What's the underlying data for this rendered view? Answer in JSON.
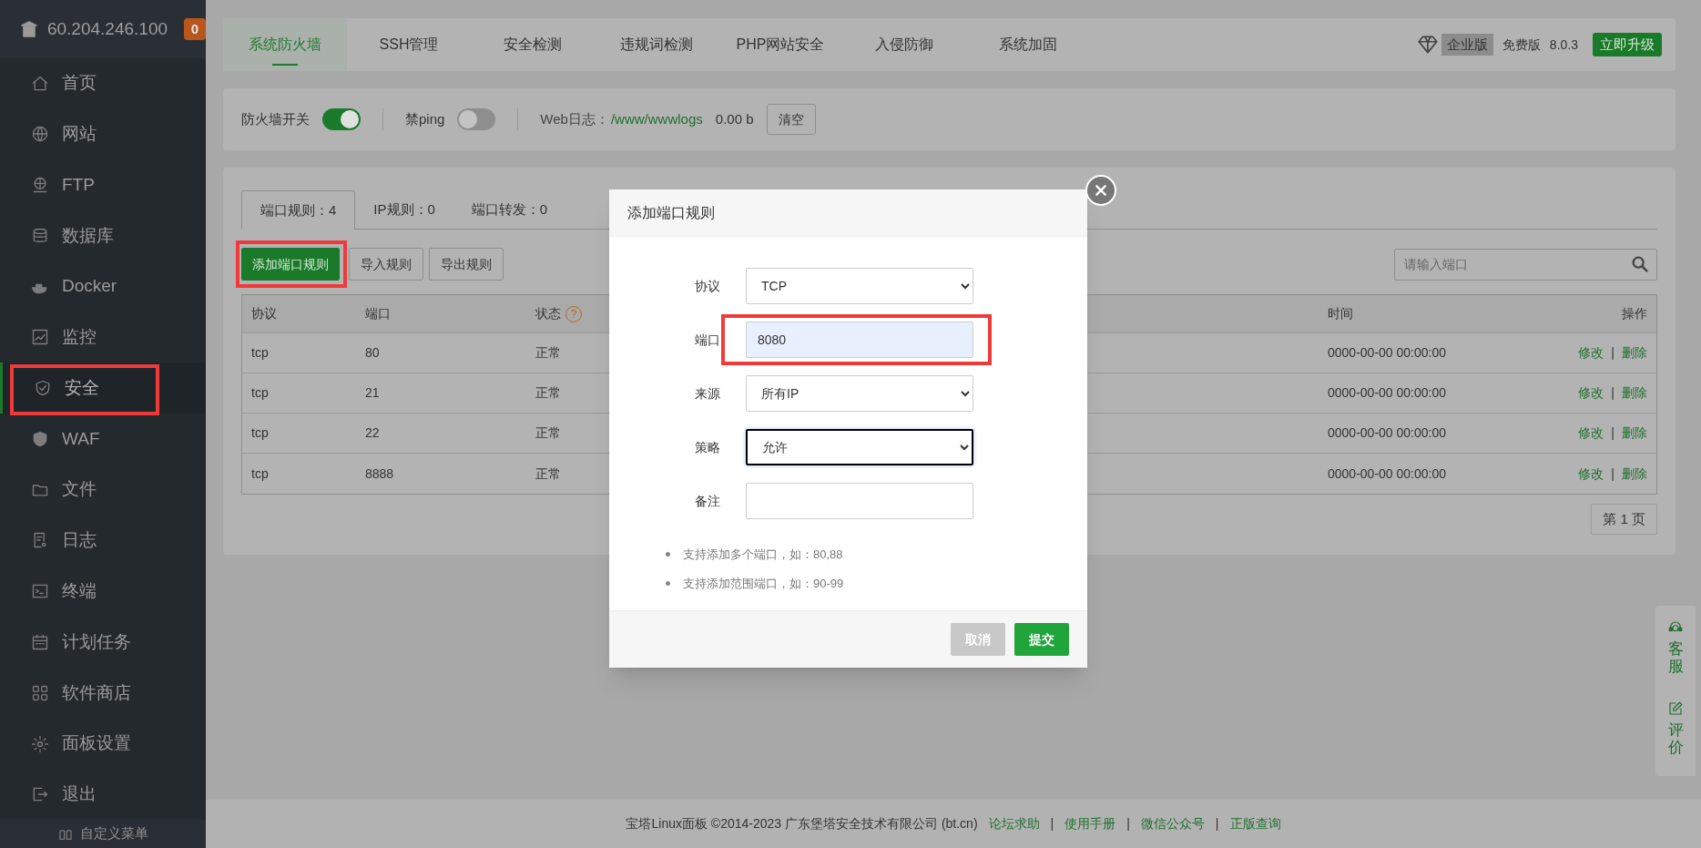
{
  "sidebar": {
    "host": "60.204.246.100",
    "badge": "0",
    "items": [
      {
        "label": "首页",
        "selected": false,
        "highlighted": false
      },
      {
        "label": "网站",
        "selected": false,
        "highlighted": false
      },
      {
        "label": "FTP",
        "selected": false,
        "highlighted": false
      },
      {
        "label": "数据库",
        "selected": false,
        "highlighted": false
      },
      {
        "label": "Docker",
        "selected": false,
        "highlighted": false
      },
      {
        "label": "监控",
        "selected": false,
        "highlighted": false
      },
      {
        "label": "安全",
        "selected": true,
        "highlighted": true
      },
      {
        "label": "WAF",
        "selected": false,
        "highlighted": false
      },
      {
        "label": "文件",
        "selected": false,
        "highlighted": false
      },
      {
        "label": "日志",
        "selected": false,
        "highlighted": false
      },
      {
        "label": "终端",
        "selected": false,
        "highlighted": false
      },
      {
        "label": "计划任务",
        "selected": false,
        "highlighted": false
      },
      {
        "label": "软件商店",
        "selected": false,
        "highlighted": false
      },
      {
        "label": "面板设置",
        "selected": false,
        "highlighted": false
      },
      {
        "label": "退出",
        "selected": false,
        "highlighted": false
      }
    ],
    "custom_menu": "自定义菜单"
  },
  "top_tabs": [
    {
      "label": "系统防火墙",
      "selected": true
    },
    {
      "label": "SSH管理",
      "selected": false
    },
    {
      "label": "安全检测",
      "selected": false
    },
    {
      "label": "违规词检测",
      "selected": false
    },
    {
      "label": "PHP网站安全",
      "selected": false
    },
    {
      "label": "入侵防御",
      "selected": false
    },
    {
      "label": "系统加固",
      "selected": false
    }
  ],
  "edition": {
    "enterprise": "企业版",
    "free": "免费版",
    "version": "8.0.3",
    "upgrade": "立即升级"
  },
  "controls": {
    "firewall_label": "防火墙开关",
    "firewall_on": true,
    "ping_label": "禁ping",
    "ping_on": false,
    "log_label": "Web日志：",
    "log_path": "/www/wwwlogs",
    "log_size": "0.00 b",
    "clear": "清空"
  },
  "rule_tabs": [
    {
      "label": "端口规则：4",
      "selected": true
    },
    {
      "label": "IP规则：0",
      "selected": false
    },
    {
      "label": "端口转发：0",
      "selected": false
    }
  ],
  "actions": [
    {
      "label": "添加端口规则",
      "primary": true,
      "highlighted": true
    },
    {
      "label": "导入规则",
      "primary": false,
      "highlighted": false
    },
    {
      "label": "导出规则",
      "primary": false,
      "highlighted": false
    }
  ],
  "search": {
    "placeholder": "请输入端口"
  },
  "table": {
    "columns": [
      {
        "label": "协议"
      },
      {
        "label": "端口"
      },
      {
        "label": "状态",
        "help": "?"
      },
      {
        "label": "时间"
      },
      {
        "label": "操作"
      }
    ],
    "separator": "|",
    "rows": [
      {
        "protocol": "tcp",
        "port": "80",
        "status": "正常",
        "time": "0000-00-00 00:00:00",
        "actions": [
          "修改",
          "删除"
        ]
      },
      {
        "protocol": "tcp",
        "port": "21",
        "status": "正常",
        "time": "0000-00-00 00:00:00",
        "actions": [
          "修改",
          "删除"
        ]
      },
      {
        "protocol": "tcp",
        "port": "22",
        "status": "正常",
        "time": "0000-00-00 00:00:00",
        "actions": [
          "修改",
          "删除"
        ]
      },
      {
        "protocol": "tcp",
        "port": "8888",
        "status": "正常",
        "time": "0000-00-00 00:00:00",
        "actions": [
          "修改",
          "删除"
        ]
      }
    ]
  },
  "pager": "第 1 页",
  "footer": {
    "text": "宝塔Linux面板 ©2014-2023 广东堡塔安全技术有限公司 (bt.cn)",
    "separator": "|",
    "links": [
      "论坛求助",
      "使用手册",
      "微信公众号",
      "正版查询"
    ]
  },
  "side_widget": [
    {
      "label": "客服",
      "kind": "headset"
    },
    {
      "label": "评价",
      "kind": "edit"
    }
  ],
  "dialog": {
    "title": "添加端口规则",
    "fields": [
      {
        "label": "协议",
        "kind": "select",
        "value": "TCP",
        "focused": false,
        "highlighted": false
      },
      {
        "label": "端口",
        "kind": "input",
        "value": "8080",
        "focused": false,
        "highlighted": true
      },
      {
        "label": "来源",
        "kind": "select",
        "value": "所有IP",
        "focused": false,
        "highlighted": false
      },
      {
        "label": "策略",
        "kind": "select",
        "value": "允许",
        "focused": true,
        "highlighted": false
      },
      {
        "label": "备注",
        "kind": "input",
        "focused": false,
        "highlighted": false
      }
    ],
    "hints": [
      "支持添加多个端口，如：80,88",
      "支持添加范围端口，如：90-99"
    ],
    "buttons": [
      {
        "label": "取消",
        "kind": "cancel"
      },
      {
        "label": "提交",
        "kind": "submit"
      }
    ]
  }
}
